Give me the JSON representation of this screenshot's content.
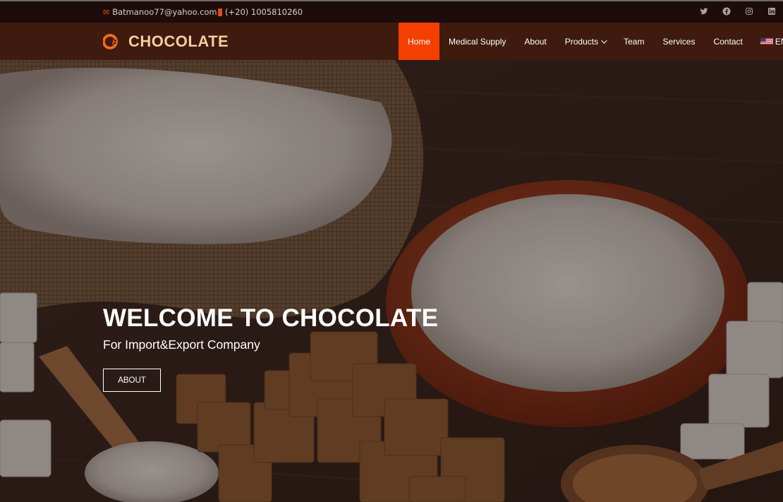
{
  "topbar": {
    "email": "Batmanoo77@yahoo.com",
    "phone": "(+20) 1005810260",
    "socials": [
      {
        "icon": "twitter-icon"
      },
      {
        "icon": "facebook-icon"
      },
      {
        "icon": "instagram-icon"
      },
      {
        "icon": "linkedin-icon"
      }
    ]
  },
  "brand": {
    "name": "CHOCOLATE",
    "logo_icon": "ch-logo-icon"
  },
  "nav": {
    "items": [
      {
        "label": "Home",
        "active": true
      },
      {
        "label": "Medical Supply"
      },
      {
        "label": "About"
      },
      {
        "label": "Products",
        "dropdown": true
      },
      {
        "label": "Team"
      },
      {
        "label": "Services"
      },
      {
        "label": "Contact"
      }
    ],
    "language": "EN"
  },
  "hero": {
    "title": "WELCOME TO CHOCOLATE",
    "subtitle": "For Import&Export Company",
    "button_label": "ABOUT"
  },
  "colors": {
    "accent": "#f43f00",
    "nav_bg": "#3e1a0f",
    "topbar_bg": "#1c0d0a",
    "brand_text": "#f3cf9c"
  }
}
